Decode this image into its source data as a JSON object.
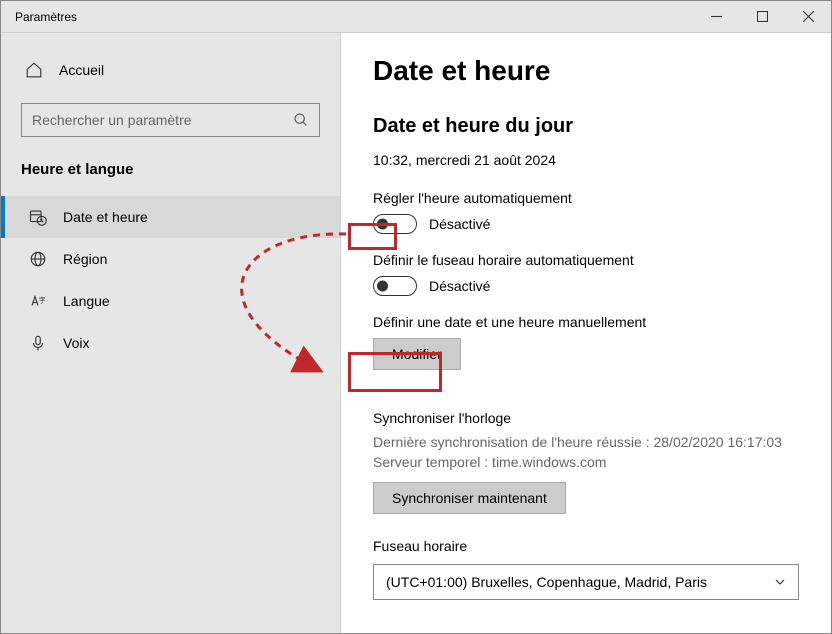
{
  "window": {
    "title": "Paramètres"
  },
  "sidebar": {
    "home_label": "Accueil",
    "search_placeholder": "Rechercher un paramètre",
    "category": "Heure et langue",
    "items": [
      {
        "label": "Date et heure",
        "icon": "clock-calendar-icon"
      },
      {
        "label": "Région",
        "icon": "globe-icon"
      },
      {
        "label": "Langue",
        "icon": "language-icon"
      },
      {
        "label": "Voix",
        "icon": "microphone-icon"
      }
    ]
  },
  "main": {
    "title": "Date et heure",
    "section_title": "Date et heure du jour",
    "current_datetime": "10:32, mercredi 21 août 2024",
    "auto_time_label": "Régler l'heure automatiquement",
    "auto_time_state": "Désactivé",
    "auto_tz_label": "Définir le fuseau horaire automatiquement",
    "auto_tz_state": "Désactivé",
    "manual_label": "Définir une date et une heure manuellement",
    "change_button": "Modifier",
    "sync_title": "Synchroniser l'horloge",
    "sync_last": "Dernière synchronisation de l'heure réussie : 28/02/2020 16:17:03",
    "sync_server": "Serveur temporel : time.windows.com",
    "sync_button": "Synchroniser maintenant",
    "tz_title": "Fuseau horaire",
    "tz_value": "(UTC+01:00) Bruxelles, Copenhague, Madrid, Paris"
  }
}
